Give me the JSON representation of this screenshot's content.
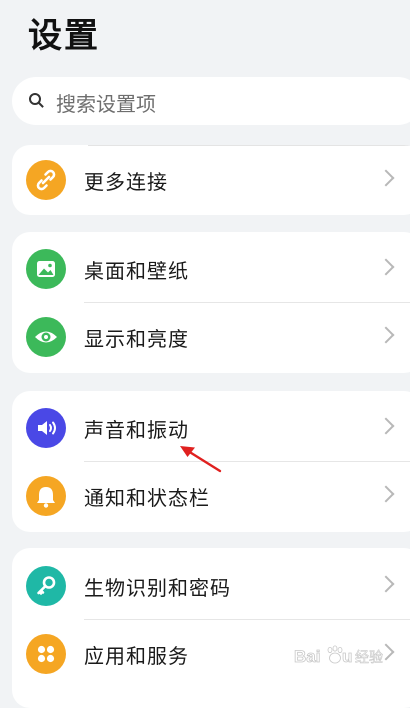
{
  "header": {
    "title": "设置"
  },
  "search": {
    "placeholder": "搜索设置项",
    "icon": "search-icon"
  },
  "groups": [
    {
      "items": [
        {
          "label": "更多连接",
          "icon": "link-icon",
          "color": "#f5a623"
        }
      ]
    },
    {
      "items": [
        {
          "label": "桌面和壁纸",
          "icon": "image-icon",
          "color": "#3cb95a"
        },
        {
          "label": "显示和亮度",
          "icon": "eye-icon",
          "color": "#3cb95a"
        }
      ]
    },
    {
      "items": [
        {
          "label": "声音和振动",
          "icon": "speaker-icon",
          "color": "#4a48e6"
        },
        {
          "label": "通知和状态栏",
          "icon": "bell-icon",
          "color": "#f5a623"
        }
      ]
    },
    {
      "items": [
        {
          "label": "生物识别和密码",
          "icon": "key-icon",
          "color": "#1fb8a6"
        },
        {
          "label": "应用和服务",
          "icon": "apps-grid-icon",
          "color": "#f5a623"
        }
      ]
    }
  ],
  "annotation": {
    "arrow_color": "#e0201f"
  },
  "watermark": {
    "text": "Baidu 经验"
  }
}
